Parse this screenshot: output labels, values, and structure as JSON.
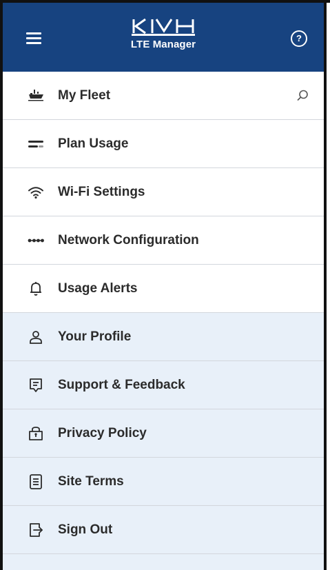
{
  "header": {
    "brand": "KVH",
    "subtitle": "LTE Manager",
    "menu_icon": "hamburger-icon",
    "help_icon": "help-circle-icon",
    "help_glyph": "?",
    "background": "#174380"
  },
  "menu": {
    "items": [
      {
        "label": "My Fleet",
        "icon": "fleet-ship-icon",
        "trailing_icon": "search-icon"
      },
      {
        "label": "Plan Usage",
        "icon": "plan-usage-bars-icon"
      },
      {
        "label": "Wi-Fi Settings",
        "icon": "wifi-icon"
      },
      {
        "label": "Network Configuration",
        "icon": "network-nodes-icon"
      },
      {
        "label": "Usage Alerts",
        "icon": "bell-icon"
      },
      {
        "label": "Your Profile",
        "icon": "user-icon"
      },
      {
        "label": "Support & Feedback",
        "icon": "feedback-icon"
      },
      {
        "label": "Privacy Policy",
        "icon": "lock-icon"
      },
      {
        "label": "Site Terms",
        "icon": "document-icon"
      },
      {
        "label": "Sign Out",
        "icon": "sign-out-icon"
      }
    ]
  },
  "colors": {
    "header": "#174380",
    "secondary_section": "#e8f0f9",
    "text": "#2b2b2b",
    "divider": "#d2d6dc"
  }
}
